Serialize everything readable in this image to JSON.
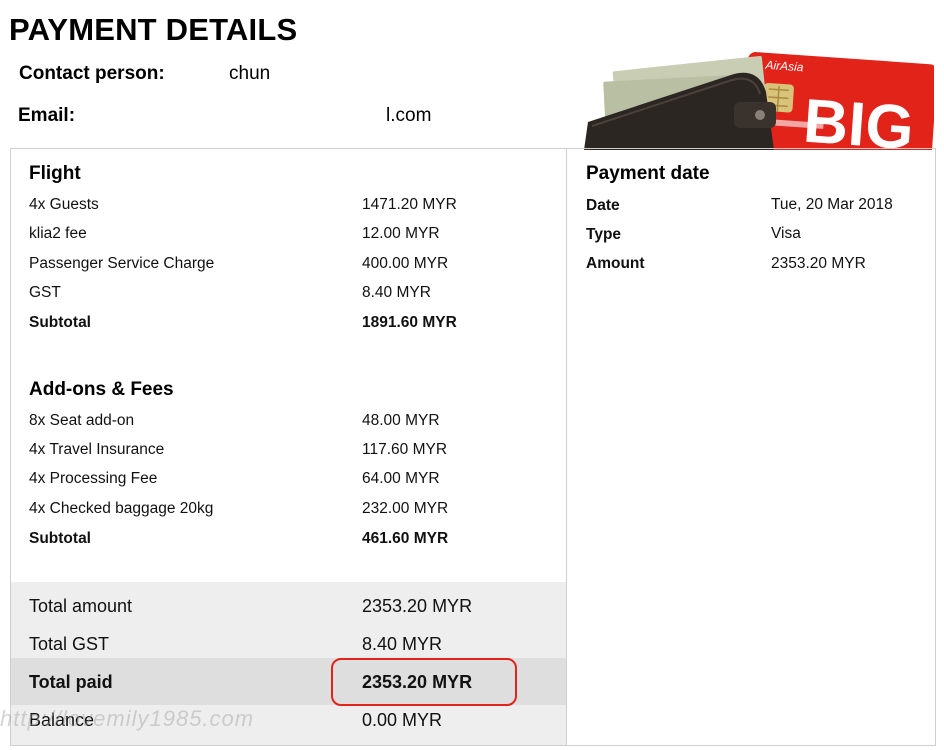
{
  "page": {
    "title": "PAYMENT DETAILS"
  },
  "contact": {
    "person_label": "Contact person:",
    "person_value": "chun",
    "email_label": "Email:",
    "email_value": "l.com"
  },
  "illustration": {
    "card_brand": "AirAsia",
    "card_text": "BIG"
  },
  "flight": {
    "title": "Flight",
    "items": [
      {
        "label": "4x Guests",
        "value": "1471.20 MYR"
      },
      {
        "label": "klia2 fee",
        "value": "12.00 MYR"
      },
      {
        "label": "Passenger Service Charge",
        "value": "400.00 MYR"
      },
      {
        "label": "GST",
        "value": "8.40 MYR"
      }
    ],
    "subtotal_label": "Subtotal",
    "subtotal_value": "1891.60 MYR"
  },
  "addons": {
    "title": "Add-ons & Fees",
    "items": [
      {
        "label": "8x Seat add-on",
        "value": "48.00 MYR"
      },
      {
        "label": "4x Travel Insurance",
        "value": "117.60 MYR"
      },
      {
        "label": "4x Processing Fee",
        "value": "64.00 MYR"
      },
      {
        "label": "4x Checked baggage 20kg",
        "value": "232.00 MYR"
      }
    ],
    "subtotal_label": "Subtotal",
    "subtotal_value": "461.60 MYR"
  },
  "totals": {
    "total_amount_label": "Total amount",
    "total_amount_value": "2353.20 MYR",
    "total_gst_label": "Total GST",
    "total_gst_value": "8.40 MYR",
    "total_paid_label": "Total paid",
    "total_paid_value": "2353.20 MYR",
    "balance_label": "Balance",
    "balance_value": "0.00 MYR"
  },
  "payment": {
    "title": "Payment date",
    "items": [
      {
        "label": "Date",
        "value": "Tue, 20 Mar 2018"
      },
      {
        "label": "Type",
        "value": "Visa"
      },
      {
        "label": "Amount",
        "value": "2353.20 MYR"
      }
    ]
  },
  "watermark": {
    "text": "http://lovemily1985.com"
  },
  "colors": {
    "highlight": "#e2231a",
    "card_red": "#e2231a"
  }
}
